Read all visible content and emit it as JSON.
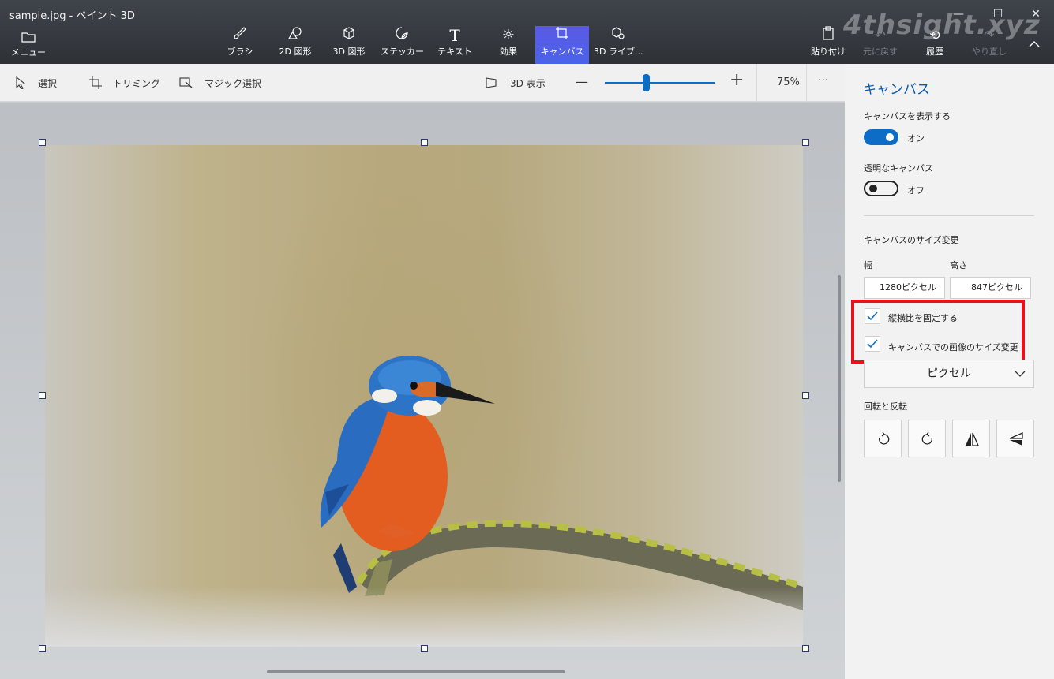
{
  "window": {
    "title": "sample.jpg - ペイント 3D",
    "watermark": "4thsight.xyz"
  },
  "ribbon": {
    "menu_label": "メニュー",
    "tools": [
      {
        "label": "ブラシ",
        "icon": "brush-icon"
      },
      {
        "label": "2D 図形",
        "icon": "2d-shapes-icon"
      },
      {
        "label": "3D 図形",
        "icon": "3d-shapes-icon"
      },
      {
        "label": "ステッカー",
        "icon": "sticker-icon"
      },
      {
        "label": "テキスト",
        "icon": "text-icon"
      },
      {
        "label": "効果",
        "icon": "effects-icon"
      },
      {
        "label": "キャンバス",
        "icon": "canvas-icon",
        "active": true
      },
      {
        "label": "3D ライブ...",
        "icon": "3d-library-icon"
      }
    ],
    "right": [
      {
        "label": "貼り付け",
        "icon": "paste-icon"
      },
      {
        "label": "元に戻す",
        "icon": "undo-icon",
        "disabled": true
      },
      {
        "label": "履歴",
        "icon": "history-icon"
      },
      {
        "label": "やり直し",
        "icon": "redo-icon",
        "disabled": true
      }
    ],
    "active_color": "#5060e8"
  },
  "subtoolbar": {
    "select_label": "選択",
    "trim_label": "トリミング",
    "magic_select_label": "マジック選択",
    "view3d_label": "3D 表示",
    "zoom_percent": "75%",
    "zoom_minus": "—",
    "zoom_plus": "+",
    "more": "···"
  },
  "panel": {
    "title": "キャンバス",
    "show_canvas_label": "キャンバスを表示する",
    "show_canvas_state": "オン",
    "transparent_label": "透明なキャンバス",
    "transparent_state": "オフ",
    "resize_heading": "キャンバスのサイズ変更",
    "width_label": "幅",
    "height_label": "高さ",
    "width_value": "1280ピクセル",
    "height_value": "847ピクセル",
    "lock_aspect_label": "縦横比を固定する",
    "resize_image_label": "キャンバスでの画像のサイズ変更",
    "unit_selected": "ピクセル",
    "rotate_heading": "回転と反転",
    "accent": "#0d6cc6",
    "highlight_color": "#e8131a"
  }
}
